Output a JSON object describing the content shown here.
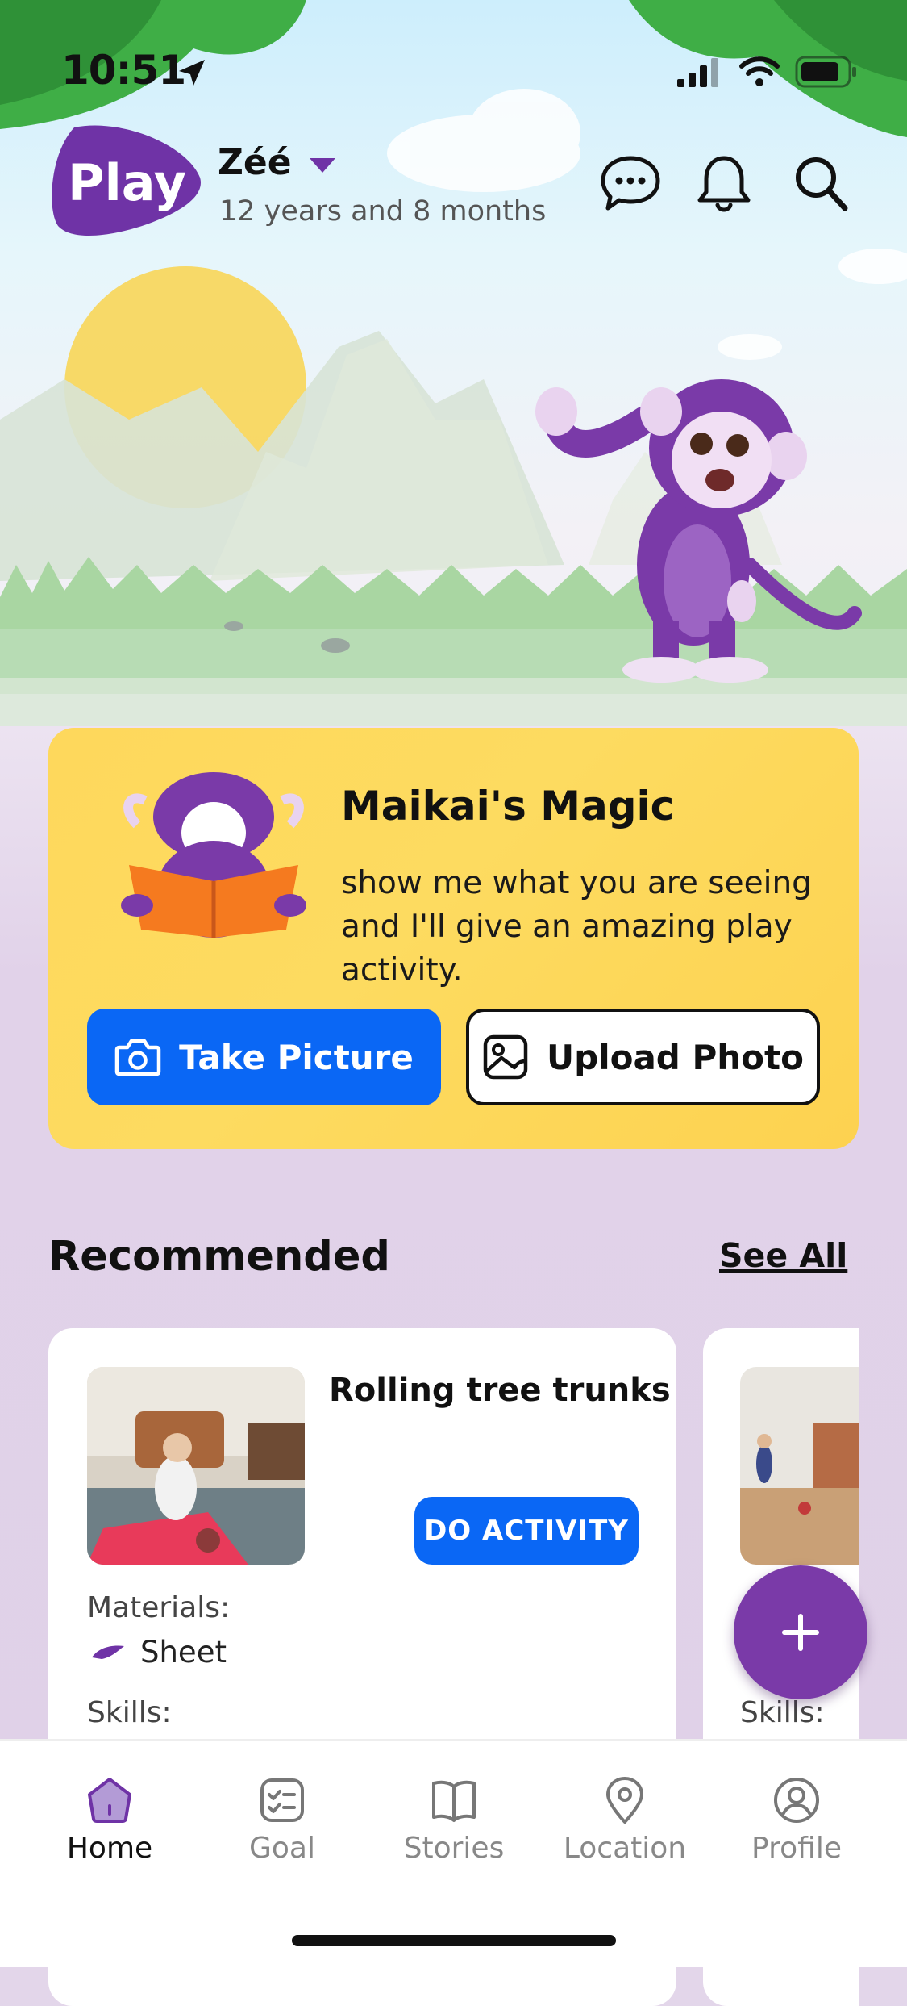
{
  "status_bar": {
    "time": "10:51"
  },
  "header": {
    "logo_text": "Play",
    "profile_name": "Zéé",
    "profile_age": "12 years and 8 months"
  },
  "magic_card": {
    "title": "Maikai's Magic",
    "text": "show me what you are seeing and I'll give an amazing play activity.",
    "take_picture_label": "Take Picture",
    "upload_photo_label": "Upload Photo"
  },
  "recommended": {
    "title": "Recommended",
    "see_all_label": "See All",
    "cards": [
      {
        "title": "Rolling tree trunks",
        "action_label": "DO ACTIVITY",
        "materials_label": "Materials:",
        "material": "Sheet",
        "skills_label": "Skills:"
      },
      {
        "skills_label": "Skills:"
      }
    ]
  },
  "tabbar": {
    "items": [
      {
        "label": "Home",
        "icon": "home-icon",
        "active": true
      },
      {
        "label": "Goal",
        "icon": "goal-checklist-icon",
        "active": false
      },
      {
        "label": "Stories",
        "icon": "book-icon",
        "active": false
      },
      {
        "label": "Location",
        "icon": "location-pin-icon",
        "active": false
      },
      {
        "label": "Profile",
        "icon": "profile-icon",
        "active": false
      }
    ]
  },
  "colors": {
    "brand_purple": "#6f33a6",
    "primary_blue": "#0a67f5",
    "card_yellow": "#fdd85a",
    "background_lavender": "#e2d3e9"
  }
}
